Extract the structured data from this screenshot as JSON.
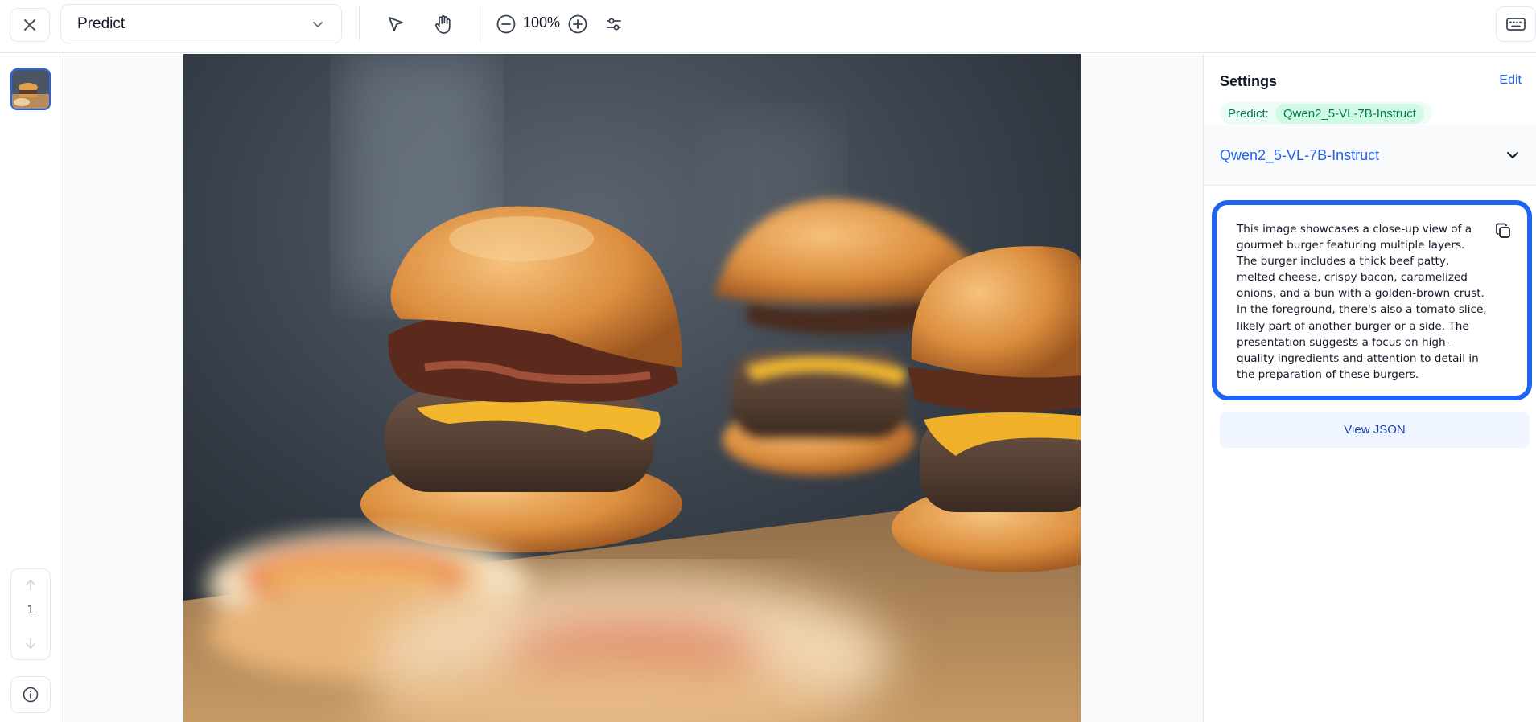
{
  "toolbar": {
    "mode_value": "Predict",
    "zoom_level": "100%",
    "icons": [
      "close-icon",
      "chevron-down-icon",
      "pointer-icon",
      "hand-icon",
      "zoom-out-icon",
      "zoom-in-icon",
      "adjustments-icon",
      "keyboard-icon"
    ]
  },
  "rail": {
    "page_number": "1",
    "icons": [
      "arrow-up-icon",
      "arrow-down-icon",
      "info-icon"
    ]
  },
  "canvas": {
    "image_subject": "burgers"
  },
  "panel": {
    "title": "Settings",
    "edit_label": "Edit",
    "predict_label": "Predict:",
    "predict_model_chip": "Qwen2_5-VL-7B-Instruct",
    "model_name": "Qwen2_5-VL-7B-Instruct",
    "result_text": "This image showcases a close-up view of a gourmet burger featuring multiple layers.\nThe burger includes a thick beef patty, melted cheese, crispy bacon, caramelized onions, and a bun with a golden-brown crust. In the foreground, there's also a tomato slice, likely part of another burger or a side. The presentation suggests a focus on high-quality ingredients and attention to detail in the preparation of these burgers.",
    "view_json_label": "View JSON"
  },
  "colors": {
    "accent": "#2563eb",
    "highlight_border": "#1d64f0",
    "predict_green": "#047857"
  }
}
